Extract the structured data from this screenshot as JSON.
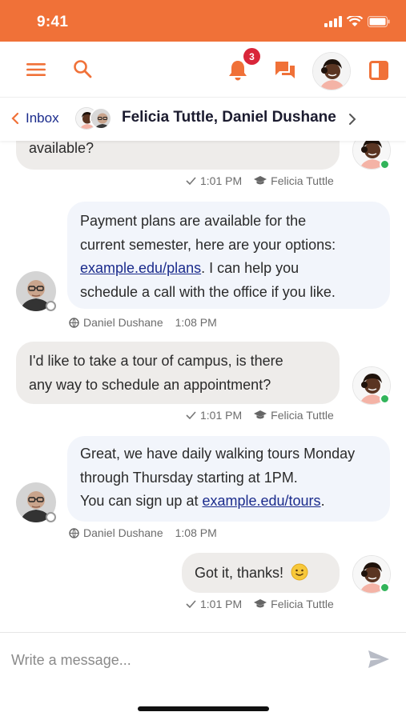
{
  "status_bar": {
    "time": "9:41"
  },
  "top_bar": {
    "notification_count": "3"
  },
  "conversation": {
    "back_label": "Inbox",
    "title": "Felicia Tuttle, Daniel Dushane"
  },
  "messages": [
    {
      "type": "incoming",
      "text": "available?",
      "time": "1:01 PM",
      "author": "Felicia Tuttle"
    },
    {
      "type": "outgoing",
      "line1": "Payment plans are available for the",
      "line2": "current semester, here are your options:",
      "link": "example.edu/plans",
      "line3_rest": ". I can help you",
      "line4": "schedule a call with the office if you like.",
      "author": "Daniel Dushane",
      "time": "1:08 PM"
    },
    {
      "type": "incoming",
      "line1": "I'd like to take a tour of campus, is there",
      "line2": "any way to schedule an appointment?",
      "time": "1:01 PM",
      "author": "Felicia Tuttle"
    },
    {
      "type": "outgoing",
      "line1": "Great, we have daily walking tours Monday",
      "line2": "through Thursday starting at 1PM.",
      "line3_pre": "You can sign up at ",
      "link": "example.edu/tours",
      "line3_post": ".",
      "author": "Daniel Dushane",
      "time": "1:08 PM"
    },
    {
      "type": "incoming",
      "text": "Got it, thanks!",
      "emoji": "🙂",
      "time": "1:01 PM",
      "author": "Felicia Tuttle"
    }
  ],
  "composer": {
    "placeholder": "Write a message..."
  },
  "colors": {
    "brand_orange": "#f07138",
    "link_blue": "#1a2b8c",
    "online_green": "#31b45a",
    "badge_red": "#d9263a"
  },
  "icons": [
    "menu-icon",
    "search-icon",
    "bell-icon",
    "chat-icon",
    "panel-icon",
    "chevron-left-icon",
    "chevron-right-icon",
    "check-icon",
    "graduation-cap-icon",
    "globe-icon",
    "send-icon"
  ]
}
